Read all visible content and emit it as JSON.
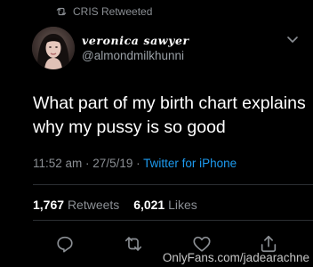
{
  "retweet_banner": {
    "icon": "retweet-icon",
    "text": "CRIS Retweeted"
  },
  "author": {
    "display_name": "veronica sawyer",
    "handle": "@almondmilkhunni",
    "menu_icon": "chevron-down-icon"
  },
  "tweet": {
    "text": "What part of my birth chart explains why my pussy is so good",
    "time": "11:52 am",
    "separator1": " · ",
    "date": "27/5/19",
    "separator2": " · ",
    "source": "Twitter for iPhone"
  },
  "stats": {
    "retweets_count": "1,767",
    "retweets_label": "Retweets",
    "likes_count": "6,021",
    "likes_label": "Likes"
  },
  "actions": {
    "reply_icon": "reply-icon",
    "retweet_icon": "retweet-icon",
    "like_icon": "heart-icon",
    "share_icon": "share-icon"
  },
  "watermark": {
    "text": "OnlyFans.com/jadearachne"
  },
  "colors": {
    "background": "#000000",
    "text": "#ffffff",
    "muted": "#8b8f94",
    "link": "#1d9bf0"
  }
}
